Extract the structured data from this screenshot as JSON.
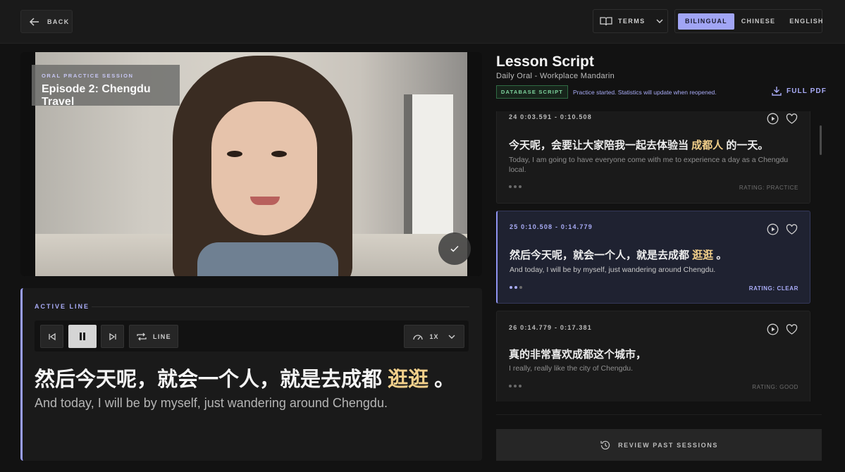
{
  "topbar": {
    "back_label": "BACK",
    "terms_label": "TERMS",
    "languages": [
      "BILINGUAL",
      "CHINESE",
      "ENGLISH"
    ],
    "active_language": "BILINGUAL"
  },
  "video": {
    "session_kicker": "ORAL PRACTICE SESSION",
    "session_title": "Episode 2: Chengdu Travel"
  },
  "active_line": {
    "kicker": "ACTIVE LINE",
    "repeat_label": "LINE",
    "speed_label": "1X",
    "zh_before": "然后今天呢，就会一个人，就是去成都 ",
    "zh_highlight": "逛逛",
    "zh_after": " 。",
    "en": "And today, I will be by myself, just wandering around Chengdu."
  },
  "lesson": {
    "title": "Lesson Script",
    "subtitle": "Daily Oral - Workplace Mandarin",
    "badge": "DATABASE SCRIPT",
    "status_note": "Practice started. Statistics will update when reopened.",
    "pdf_label": "FULL PDF"
  },
  "script_lines": [
    {
      "time": "24 0:03.591 - 0:10.508",
      "zh_before": "今天呢，会要让大家陪我一起去体验当 ",
      "zh_highlight": "成都人",
      "zh_after": " 的一天。",
      "en": "Today, I am going to have everyone come with me to experience a day as a Chengdu local.",
      "rating": "RATING: PRACTICE",
      "active": false
    },
    {
      "time": "25 0:10.508 - 0:14.779",
      "zh_before": "然后今天呢，就会一个人，就是去成都 ",
      "zh_highlight": "逛逛",
      "zh_after": " 。",
      "en": "And today, I will be by myself, just wandering around Chengdu.",
      "rating": "RATING: CLEAR",
      "active": true
    },
    {
      "time": "26 0:14.779 - 0:17.381",
      "zh_before": "真的非常喜欢成都这个城市，",
      "zh_highlight": "",
      "zh_after": "",
      "en": "I really, really like the city of Chengdu.",
      "rating": "RATING: GOOD",
      "active": false
    }
  ],
  "review_label": "REVIEW PAST SESSIONS",
  "colors": {
    "accent": "#a1a5f5",
    "highlight": "#f2cf8a",
    "badge_green": "#7ed39d",
    "background": "#121212"
  }
}
